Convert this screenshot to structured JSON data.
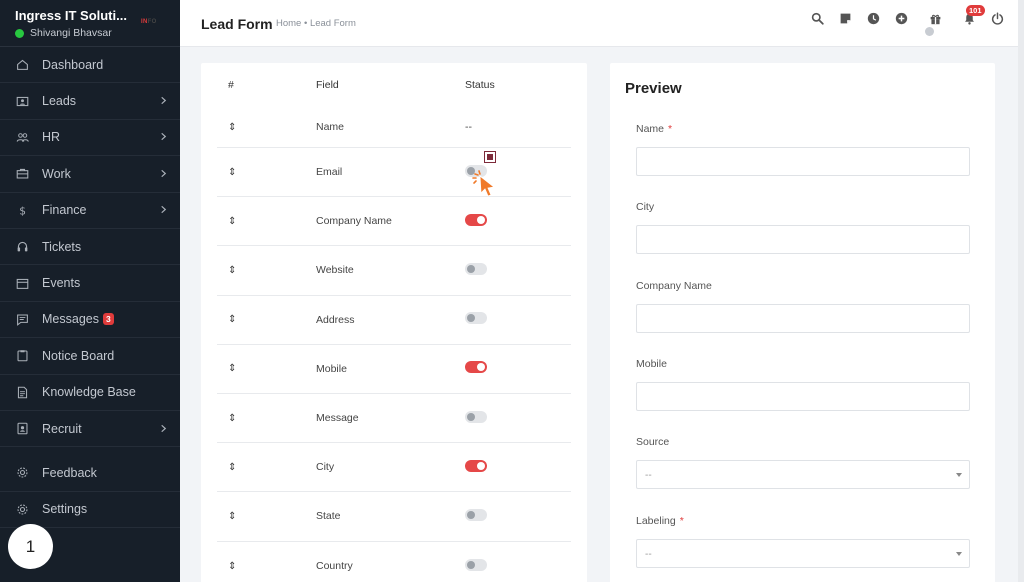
{
  "brand": {
    "name": "Ingress IT Soluti...",
    "user": "Shivangi Bhavsar",
    "logo_red": "IN",
    "logo_rest": "FO"
  },
  "sidebar": {
    "items": [
      {
        "label": "Dashboard",
        "icon": "house-icon",
        "chevron": false
      },
      {
        "label": "Leads",
        "icon": "id-card-icon",
        "chevron": true
      },
      {
        "label": "HR",
        "icon": "people-icon",
        "chevron": true
      },
      {
        "label": "Work",
        "icon": "briefcase-icon",
        "chevron": true
      },
      {
        "label": "Finance",
        "icon": "dollar-icon",
        "chevron": true
      },
      {
        "label": "Tickets",
        "icon": "headset-icon",
        "chevron": false
      },
      {
        "label": "Events",
        "icon": "calendar-icon",
        "chevron": false
      },
      {
        "label": "Messages",
        "icon": "message-icon",
        "chevron": false,
        "badge": "3"
      },
      {
        "label": "Notice Board",
        "icon": "clipboard-icon",
        "chevron": false
      },
      {
        "label": "Knowledge Base",
        "icon": "document-icon",
        "chevron": false
      },
      {
        "label": "Recruit",
        "icon": "badge-icon",
        "chevron": true
      },
      {
        "label": "Feedback",
        "icon": "gear-icon",
        "chevron": false
      },
      {
        "label": "Settings",
        "icon": "gear-icon",
        "chevron": false
      }
    ],
    "step_number": "1"
  },
  "header": {
    "title": "Lead Form",
    "breadcrumb": "Home • Lead Form",
    "notification_count": "101",
    "icons": [
      "search-icon",
      "sticky-note-icon",
      "clock-icon",
      "plus-circle-icon",
      "gift-icon",
      "bell-icon",
      "power-icon"
    ]
  },
  "fields_table": {
    "headers": {
      "hash": "#",
      "field": "Field",
      "status": "Status"
    },
    "rows": [
      {
        "handle": "⇕",
        "field": "Name",
        "status": "--",
        "on": null
      },
      {
        "handle": "⇕",
        "field": "Email",
        "status": "",
        "on": false
      },
      {
        "handle": "⇕",
        "field": "Company Name",
        "status": "",
        "on": true
      },
      {
        "handle": "⇕",
        "field": "Website",
        "status": "",
        "on": false
      },
      {
        "handle": "⇕",
        "field": "Address",
        "status": "",
        "on": false
      },
      {
        "handle": "⇕",
        "field": "Mobile",
        "status": "",
        "on": true
      },
      {
        "handle": "⇕",
        "field": "Message",
        "status": "",
        "on": false
      },
      {
        "handle": "⇕",
        "field": "City",
        "status": "",
        "on": true
      },
      {
        "handle": "⇕",
        "field": "State",
        "status": "",
        "on": false
      },
      {
        "handle": "⇕",
        "field": "Country",
        "status": "",
        "on": false
      }
    ]
  },
  "preview": {
    "title": "Preview",
    "fields": [
      {
        "label": "Name",
        "required": true,
        "type": "input",
        "value": ""
      },
      {
        "label": "City",
        "required": false,
        "type": "input",
        "value": ""
      },
      {
        "label": "Company Name",
        "required": false,
        "type": "input",
        "value": ""
      },
      {
        "label": "Mobile",
        "required": false,
        "type": "input",
        "value": ""
      },
      {
        "label": "Source",
        "required": false,
        "type": "select",
        "value": "--"
      },
      {
        "label": "Labeling",
        "required": true,
        "type": "select",
        "value": "--"
      }
    ]
  },
  "colors": {
    "sidebar_bg": "#171f29",
    "accent_red": "#e54848",
    "online_green": "#28c840"
  }
}
